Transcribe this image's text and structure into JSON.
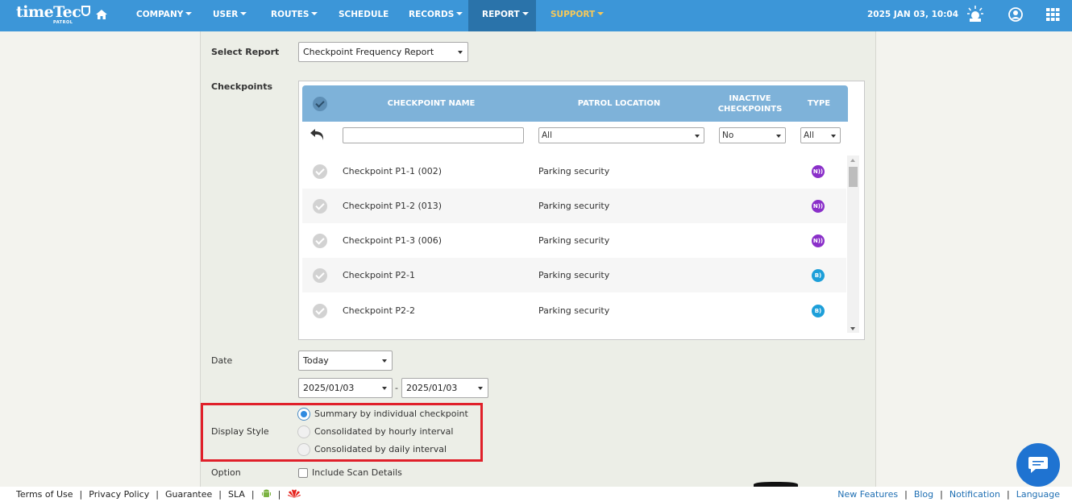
{
  "brand": {
    "logo_text": "timeTec",
    "logo_sub": "PATROL"
  },
  "nav": {
    "items": [
      {
        "label": "COMPANY",
        "caret": true
      },
      {
        "label": "USER",
        "caret": true
      },
      {
        "label": "ROUTES",
        "caret": true
      },
      {
        "label": "SCHEDULE",
        "caret": false
      },
      {
        "label": "RECORDS",
        "caret": true
      },
      {
        "label": "REPORT",
        "caret": true,
        "active": true
      },
      {
        "label": "SUPPORT",
        "caret": true,
        "highlight": true
      }
    ],
    "datetime": "2025 JAN 03, 10:04",
    "icons": [
      "home-icon",
      "alarm-icon",
      "profile-icon",
      "apps-grid-icon"
    ]
  },
  "form": {
    "select_report_label": "Select Report",
    "select_report_value": "Checkpoint Frequency Report",
    "checkpoints_label": "Checkpoints",
    "table": {
      "headers": {
        "name": "CHECKPOINT NAME",
        "location": "PATROL LOCATION",
        "inactive_line1": "INACTIVE",
        "inactive_line2": "CHECKPOINTS",
        "type": "TYPE"
      },
      "filters": {
        "name_value": "",
        "location_value": "All",
        "inactive_value": "No",
        "type_value": "All"
      },
      "rows": [
        {
          "name": "Checkpoint P1-1 (002)",
          "location": "Parking security",
          "type": "nfc"
        },
        {
          "name": "Checkpoint P1-2 (013)",
          "location": "Parking security",
          "type": "nfc"
        },
        {
          "name": "Checkpoint P1-3 (006)",
          "location": "Parking security",
          "type": "nfc"
        },
        {
          "name": "Checkpoint P2-1",
          "location": "Parking security",
          "type": "ble"
        },
        {
          "name": "Checkpoint P2-2",
          "location": "Parking security",
          "type": "ble"
        }
      ]
    },
    "date_label": "Date",
    "date_range_value": "Today",
    "date_from": "2025/01/03",
    "date_separator": "-",
    "date_to": "2025/01/03",
    "display_style_label": "Display Style",
    "display_options": [
      {
        "label": "Summary by individual checkpoint",
        "selected": true
      },
      {
        "label": "Consolidated by hourly interval",
        "selected": false
      },
      {
        "label": "Consolidated by daily interval",
        "selected": false
      }
    ],
    "option_label": "Option",
    "include_scan_details": "Include Scan Details"
  },
  "footer": {
    "left": [
      "Terms of Use",
      "Privacy Policy",
      "Guarantee",
      "SLA"
    ],
    "right": [
      "New Features",
      "Blog",
      "Notification",
      "Language"
    ]
  },
  "colors": {
    "nav_bg": "#3c96d8",
    "nav_active": "#2a73aa",
    "support": "#f6c95a",
    "table_header": "#7eb2d9",
    "highlight_border": "#e0202a",
    "nfc": "#8a2fc9",
    "ble": "#1d9fd9"
  }
}
